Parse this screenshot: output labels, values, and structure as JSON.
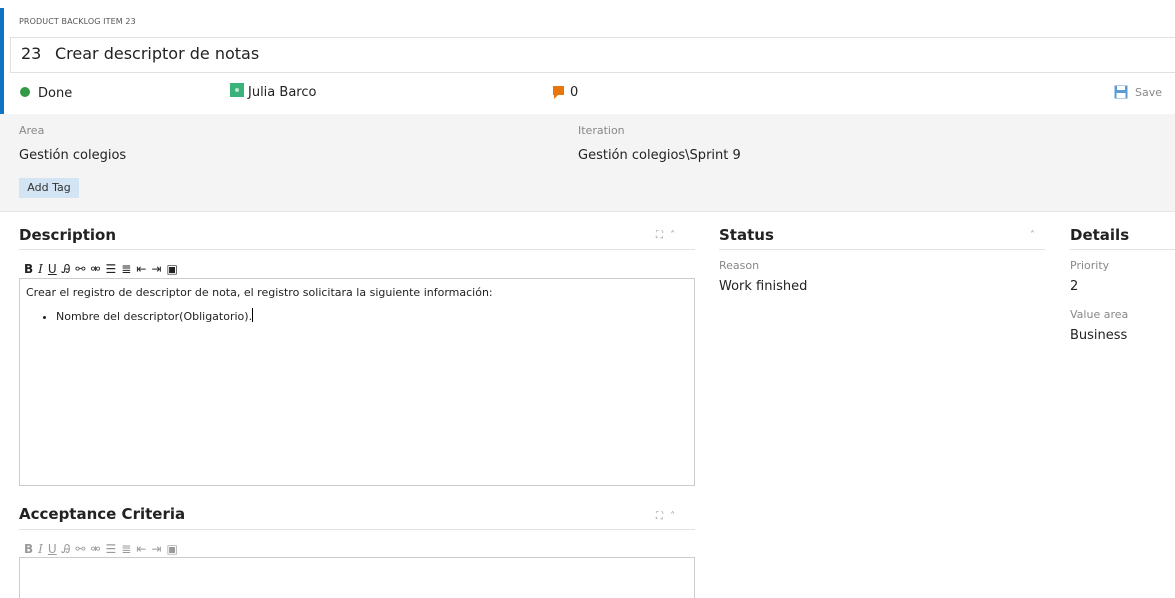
{
  "work_item": {
    "type_label": "PRODUCT BACKLOG ITEM 23",
    "id": "23",
    "title": "Crear descriptor de notas"
  },
  "header": {
    "state": "Done",
    "assignee": "Julia Barco",
    "comment_count": "0",
    "save_label": "Save"
  },
  "fields": {
    "area_label": "Area",
    "area_value": "Gestión colegios",
    "iteration_label": "Iteration",
    "iteration_value": "Gestión colegios\\Sprint 9",
    "add_tag_label": "Add Tag"
  },
  "description": {
    "title": "Description",
    "text": "Crear el registro de descriptor de nota, el registro solicitara la siguiente información:",
    "bullets": [
      "Nombre del descriptor(Obligatorio)."
    ]
  },
  "acceptance": {
    "title": "Acceptance Criteria"
  },
  "status": {
    "title": "Status",
    "reason_label": "Reason",
    "reason_value": "Work finished"
  },
  "details": {
    "title": "Details",
    "priority_label": "Priority",
    "priority_value": "2",
    "value_area_label": "Value area",
    "value_area_value": "Business"
  },
  "colors": {
    "accent": "#0f73c3",
    "state_done": "#339947",
    "comment": "#e8750d",
    "tag_bg": "#d3e4f4"
  }
}
